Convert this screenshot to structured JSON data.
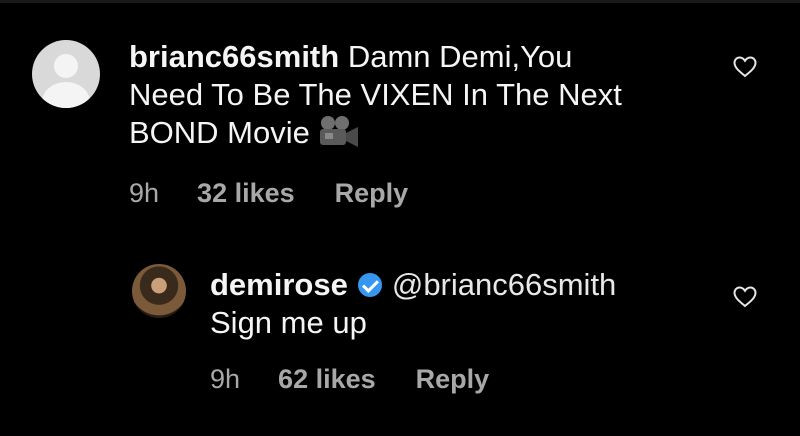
{
  "comments": [
    {
      "username": "brianc66smith",
      "text_lines": [
        "Damn Demi,You",
        "Need To Be The VIXEN In The Next",
        "BOND Movie"
      ],
      "time": "9h",
      "likes": "32 likes",
      "reply_label": "Reply",
      "avatar": "default-avatar",
      "trailing_icon": "movie-camera-icon"
    },
    {
      "username": "demirose",
      "verified": true,
      "mention": "@brianc66smith",
      "text": "Sign me up",
      "time": "9h",
      "likes": "62 likes",
      "reply_label": "Reply",
      "avatar": "profile-photo"
    }
  ],
  "icons": {
    "like": "heart-outline-icon",
    "verified": "verified-badge-icon"
  },
  "colors": {
    "background": "#000000",
    "text": "#f5f5f5",
    "meta": "#a8a8a8",
    "verified": "#3797f0"
  }
}
